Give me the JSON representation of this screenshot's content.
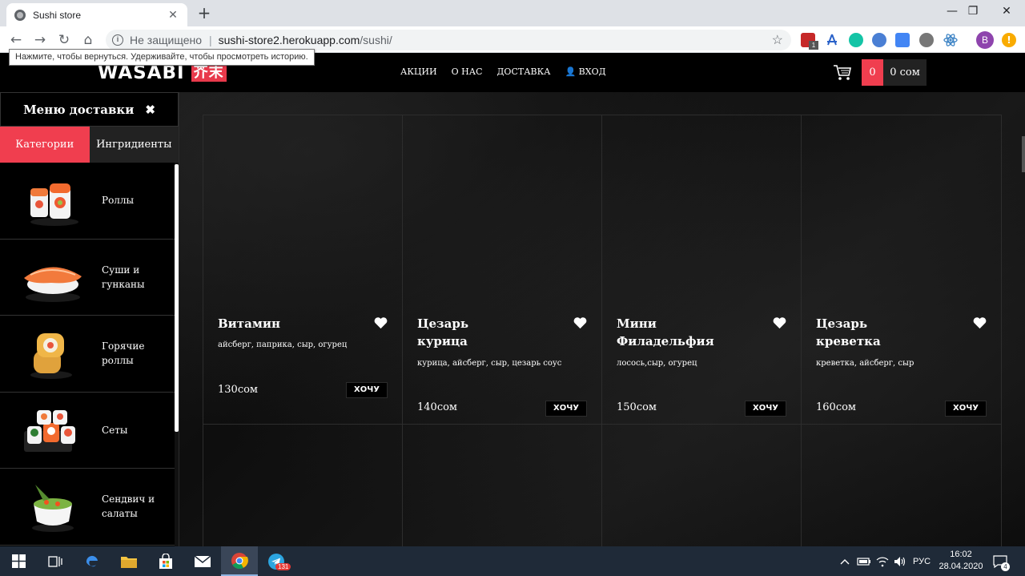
{
  "browser": {
    "tab_title": "Sushi store",
    "tab_close": "✕",
    "new_tab": "+",
    "window_controls": {
      "minimize": "—",
      "restore": "❐",
      "close": "✕"
    },
    "security_label": "Не защищено",
    "url_host": "sushi-store2.herokuapp.com",
    "url_path": "/sushi/",
    "tooltip": "Нажмите, чтобы вернуться. Удерживайте, чтобы просмотреть историю.",
    "profile_initial": "B",
    "update_badge": "!",
    "extension_badge": "1"
  },
  "header": {
    "logo_text": "WASABI",
    "logo_kanji": "芥末",
    "nav": [
      "АКЦИИ",
      "О НАС",
      "ДОСТАВКА",
      "ВХОД"
    ],
    "cart_count": "0",
    "cart_total": "0 сом"
  },
  "sidebar": {
    "title": "Меню доставки",
    "close": "✖",
    "tabs": {
      "categories": "Категории",
      "ingredients": "Ингридиенты"
    },
    "items": [
      {
        "label": "Роллы",
        "icon": "roll-icon"
      },
      {
        "label": "Суши и гунканы",
        "icon": "nigiri-icon"
      },
      {
        "label": "Горячие роллы",
        "icon": "hot-roll-icon"
      },
      {
        "label": "Сеты",
        "icon": "set-icon"
      },
      {
        "label": "Сендвич и салаты",
        "icon": "salad-icon"
      }
    ]
  },
  "products": [
    {
      "name": "Витамин",
      "desc": "айсберг, паприка, сыр, огурец",
      "price": "130сом",
      "button": "ХОЧУ"
    },
    {
      "name": "Цезарь курица",
      "desc": "курица, айсберг, сыр, цезарь соус",
      "price": "140сом",
      "button": "ХОЧУ"
    },
    {
      "name": "Мини Филадельфия",
      "desc": "лосось,сыр, огурец",
      "price": "150сом",
      "button": "ХОЧУ"
    },
    {
      "name": "Цезарь креветка",
      "desc": "креветка, айсберг, сыр",
      "price": "160сом",
      "button": "ХОЧУ"
    }
  ],
  "taskbar": {
    "language": "РУС",
    "time": "16:02",
    "date": "28.04.2020",
    "telegram_badge": "131",
    "notifications_badge": "4"
  },
  "colors": {
    "accent": "#f03e4f",
    "logo_red": "#e8394b",
    "header_bg": "#000000"
  }
}
